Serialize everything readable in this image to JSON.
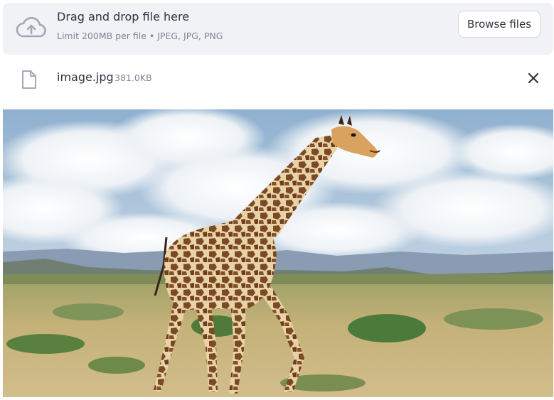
{
  "uploader": {
    "title": "Drag and drop file here",
    "subtitle": "Limit 200MB per file • JPEG, JPG, PNG",
    "browse_label": "Browse files",
    "icon": "cloud-upload-icon"
  },
  "file": {
    "name": "image.jpg",
    "size": "381.0KB",
    "icon": "file-icon",
    "remove_icon": "close-icon"
  },
  "image": {
    "subject": "giraffe"
  },
  "colors": {
    "dropzone_bg": "#f0f2f6",
    "text": "#31333f",
    "muted": "#808495"
  }
}
